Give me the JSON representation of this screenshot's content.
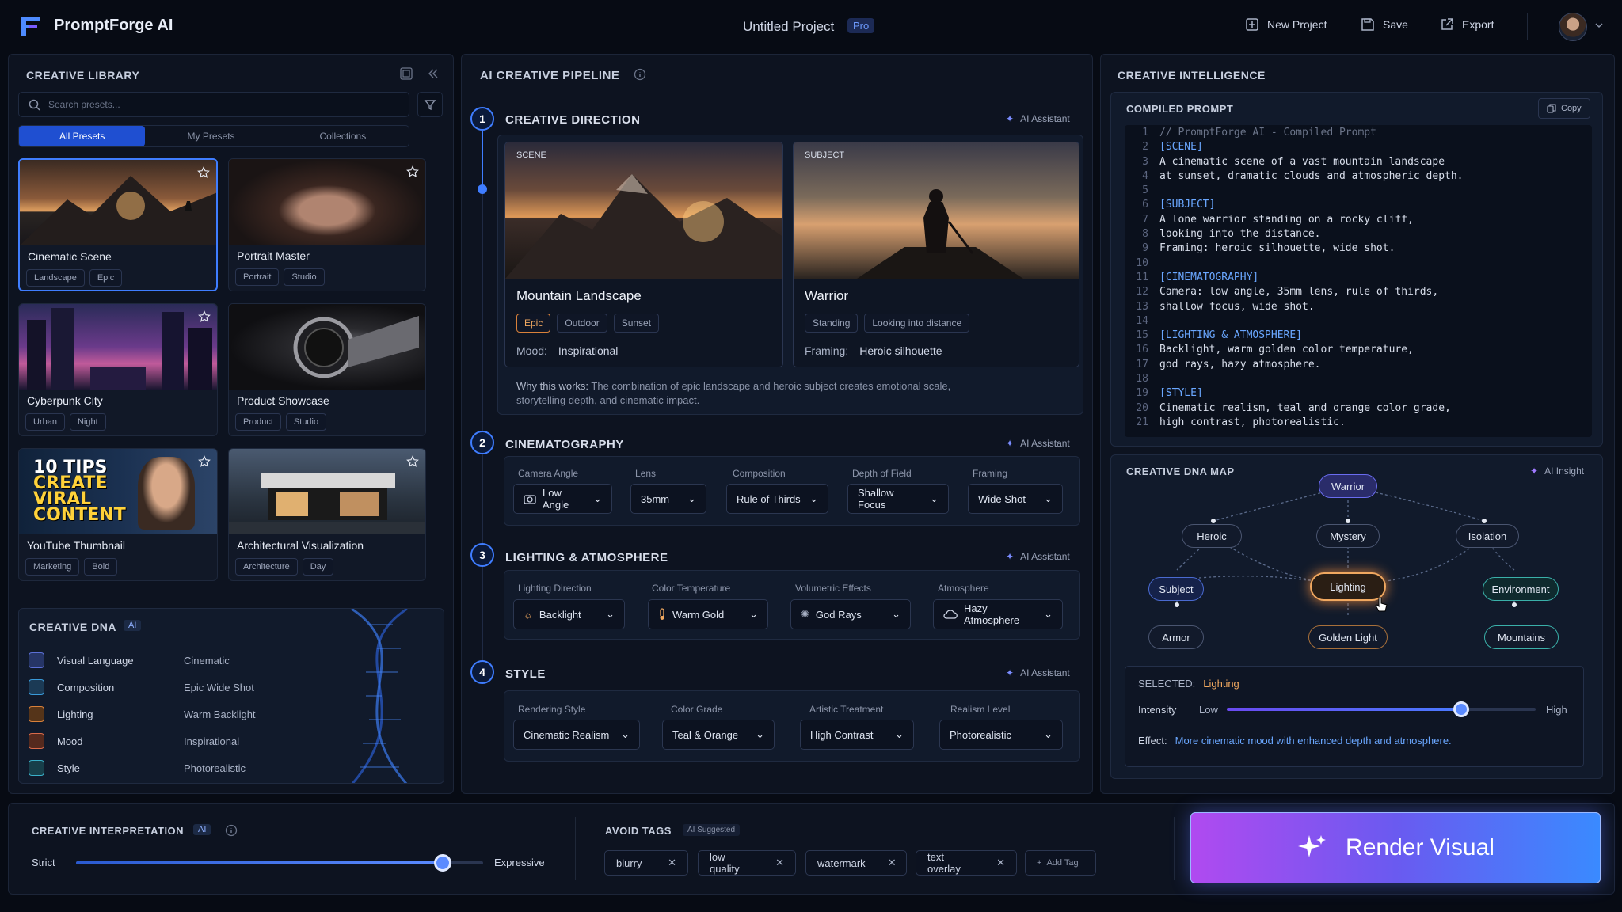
{
  "app": {
    "name": "PromptForge AI",
    "project": "Untitled Project",
    "plan_badge": "Pro",
    "new_project": "New Project",
    "save": "Save",
    "export": "Export"
  },
  "library": {
    "title": "CREATIVE LIBRARY",
    "search_placeholder": "Search presets...",
    "tabs": [
      "All Presets",
      "My Presets",
      "Collections"
    ],
    "presets": [
      {
        "name": "Cinematic Scene",
        "tags": [
          "Landscape",
          "Epic"
        ]
      },
      {
        "name": "Portrait Master",
        "tags": [
          "Portrait",
          "Studio"
        ]
      },
      {
        "name": "Cyberpunk City",
        "tags": [
          "Urban",
          "Night"
        ]
      },
      {
        "name": "Product Showcase",
        "tags": [
          "Product",
          "Studio"
        ]
      },
      {
        "name": "YouTube Thumbnail",
        "tags": [
          "Marketing",
          "Bold"
        ],
        "thumb_text": [
          "10 TIPS",
          "CREATE",
          "VIRAL",
          "CONTENT"
        ]
      },
      {
        "name": "Architectural Visualization",
        "tags": [
          "Architecture",
          "Day"
        ]
      }
    ]
  },
  "dna": {
    "title": "CREATIVE DNA",
    "badge": "AI",
    "rows": [
      {
        "label": "Visual Language",
        "value": "Cinematic",
        "color": "#5b6fd6"
      },
      {
        "label": "Composition",
        "value": "Epic Wide Shot",
        "color": "#3a9ad9"
      },
      {
        "label": "Lighting",
        "value": "Warm Backlight",
        "color": "#d9813a"
      },
      {
        "label": "Mood",
        "value": "Inspirational",
        "color": "#d96a4a"
      },
      {
        "label": "Style",
        "value": "Photorealistic",
        "color": "#3ab0c9"
      }
    ]
  },
  "pipeline": {
    "title": "AI CREATIVE PIPELINE",
    "ai_assistant": "AI Assistant",
    "steps": [
      {
        "num": "1",
        "title": "CREATIVE DIRECTION"
      },
      {
        "num": "2",
        "title": "CINEMATOGRAPHY"
      },
      {
        "num": "3",
        "title": "LIGHTING & ATMOSPHERE"
      },
      {
        "num": "4",
        "title": "STYLE"
      }
    ],
    "scene": {
      "label": "SCENE",
      "name": "Mountain Landscape",
      "tags": [
        "Epic",
        "Outdoor",
        "Sunset"
      ],
      "meta_label": "Mood:",
      "meta_value": "Inspirational"
    },
    "subject": {
      "label": "SUBJECT",
      "name": "Warrior",
      "tags": [
        "Standing",
        "Looking into distance"
      ],
      "meta_label": "Framing:",
      "meta_value": "Heroic silhouette"
    },
    "why_label": "Why this works:",
    "why_text": "The combination of epic landscape and heroic subject creates emotional scale, storytelling depth, and cinematic impact.",
    "cinematography": [
      {
        "label": "Camera Angle",
        "value": "Low Angle",
        "icon": "camera-icon"
      },
      {
        "label": "Lens",
        "value": "35mm"
      },
      {
        "label": "Composition",
        "value": "Rule of Thirds"
      },
      {
        "label": "Depth of Field",
        "value": "Shallow Focus"
      },
      {
        "label": "Framing",
        "value": "Wide Shot"
      }
    ],
    "lighting": [
      {
        "label": "Lighting Direction",
        "value": "Backlight",
        "icon": "sun-icon"
      },
      {
        "label": "Color Temperature",
        "value": "Warm Gold",
        "icon": "thermometer-icon"
      },
      {
        "label": "Volumetric Effects",
        "value": "God Rays",
        "icon": "rays-icon"
      },
      {
        "label": "Atmosphere",
        "value": "Hazy Atmosphere",
        "icon": "cloud-icon"
      }
    ],
    "style": [
      {
        "label": "Rendering Style",
        "value": "Cinematic Realism"
      },
      {
        "label": "Color Grade",
        "value": "Teal & Orange"
      },
      {
        "label": "Artistic Treatment",
        "value": "High Contrast"
      },
      {
        "label": "Realism Level",
        "value": "Photorealistic"
      }
    ]
  },
  "intel": {
    "title": "CREATIVE INTELLIGENCE",
    "prompt_title": "COMPILED PROMPT",
    "copy": "Copy",
    "code": [
      "// PromptForge AI - Compiled Prompt",
      "[SCENE]",
      "A cinematic scene of a vast mountain landscape",
      "at sunset, dramatic clouds and atmospheric depth.",
      "",
      "[SUBJECT]",
      "A lone warrior standing on a rocky cliff,",
      "looking into the distance.",
      "Framing: heroic silhouette, wide shot.",
      "",
      "[CINEMATOGRAPHY]",
      "Camera: low angle, 35mm lens, rule of thirds,",
      "shallow focus, wide shot.",
      "",
      "[LIGHTING & ATMOSPHERE]",
      "Backlight, warm golden color temperature,",
      "god rays, hazy atmosphere.",
      "",
      "[STYLE]",
      "Cinematic realism, teal and orange color grade,",
      "high contrast, photorealistic."
    ],
    "map_title": "CREATIVE DNA MAP",
    "ai_insight": "AI Insight",
    "nodes": [
      "Warrior",
      "Heroic",
      "Mystery",
      "Isolation",
      "Subject",
      "Lighting",
      "Environment",
      "Armor",
      "Golden Light",
      "Mountains"
    ],
    "selected_label": "SELECTED:",
    "selected_value": "Lighting",
    "intensity_label": "Intensity",
    "low": "Low",
    "high": "High",
    "intensity_value": 0.76,
    "effect_label": "Effect:",
    "effect_text": "More cinematic mood with enhanced depth and atmosphere."
  },
  "bottom": {
    "interp_title": "CREATIVE INTERPRETATION",
    "interp_badge": "AI",
    "strict": "Strict",
    "expressive": "Expressive",
    "interp_value": 0.9,
    "avoid_title": "AVOID TAGS",
    "avoid_badge": "AI Suggested",
    "avoid_tags": [
      "blurry",
      "low quality",
      "watermark",
      "text overlay"
    ],
    "add_tag": "Add Tag",
    "render": "Render Visual"
  }
}
